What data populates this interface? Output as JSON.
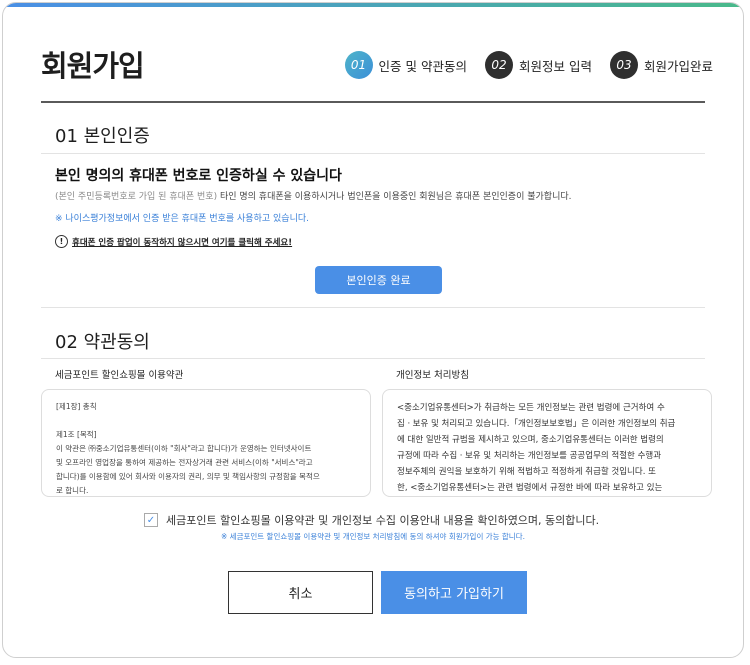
{
  "header": {
    "title": "회원가입",
    "steps": [
      {
        "num": "01",
        "label": "인증 및 약관동의",
        "active": true
      },
      {
        "num": "02",
        "label": "회원정보 입력",
        "active": false
      },
      {
        "num": "03",
        "label": "회원가입완료",
        "active": false
      }
    ]
  },
  "cert": {
    "section_title": "01 본인인증",
    "heading": "본인 명의의 휴대폰 번호로 인증하실 수 있습니다",
    "desc_muted": "(본인 주민등록번호로 가입 된 휴대폰 번호)",
    "desc": " 타인 명의 휴대폰을 이용하시거나 법인폰을 이용중인 회원님은 휴대폰 본인인증이 불가합니다.",
    "note": "※ 나이스평가정보에서 인증 받은 휴대폰 번호를 사용하고 있습니다.",
    "popup_help": "휴대폰 인증 팝업이 동작하지 않으시면 여기를 클릭해 주세요!",
    "button_label": "본인인증 완료"
  },
  "terms": {
    "section_title": "02 약관동의",
    "shop_label": "세금포인트 할인쇼핑몰 이용약관",
    "shop_lines": [
      "[제1장] 총칙",
      "",
      "제1조 [목적]",
      "이 약관은 ㈜중소기업유통센터(이하 \"회사\"라고 합니다)가 운영하는 인터넷사이트",
      "및 오프라인 영업장을 통하여 제공하는 전자상거래 관련 서비스(이하 \"서비스\"라고",
      "합니다)를 이용함에 있어 회사와 이용자의 권리, 의무 및 책임사항의 규정함을 목적으",
      "로 합니다."
    ],
    "privacy_label": "개인정보 처리방침",
    "privacy_lines": [
      "<중소기업유통센터>가 취급하는 모든 개인정보는 관련 법령에 근거하여 수",
      "집ㆍ보유 및 처리되고 있습니다.「개인정보보호법」은 이러한 개인정보의 취급",
      "에 대한 일반적 규범을 제시하고 있으며, 중소기업유통센터는 이러한 법령의",
      "규정에 따라 수집ㆍ보유 및 처리하는 개인정보를 공공업무의 적절한 수행과",
      "정보주체의 권익을 보호하기 위해 적법하고 적정하게 취급할 것입니다. 또",
      "한, <중소기업유통센터>는 관련 법령에서 규정한 바에 따라 보유하고 있는"
    ],
    "agree_check": "✓",
    "agree_label": "세금포인트 할인쇼핑몰 이용약관 및 개인정보 수집 이용안내 내용을 확인하였으며, 동의합니다.",
    "agree_note": "※ 세금포인트 할인쇼핑몰 이용약관 및 개인정보 처리방침에 동의 하셔야 회원가입이 가능 합니다."
  },
  "actions": {
    "cancel_label": "취소",
    "join_label": "동의하고 가입하기"
  }
}
